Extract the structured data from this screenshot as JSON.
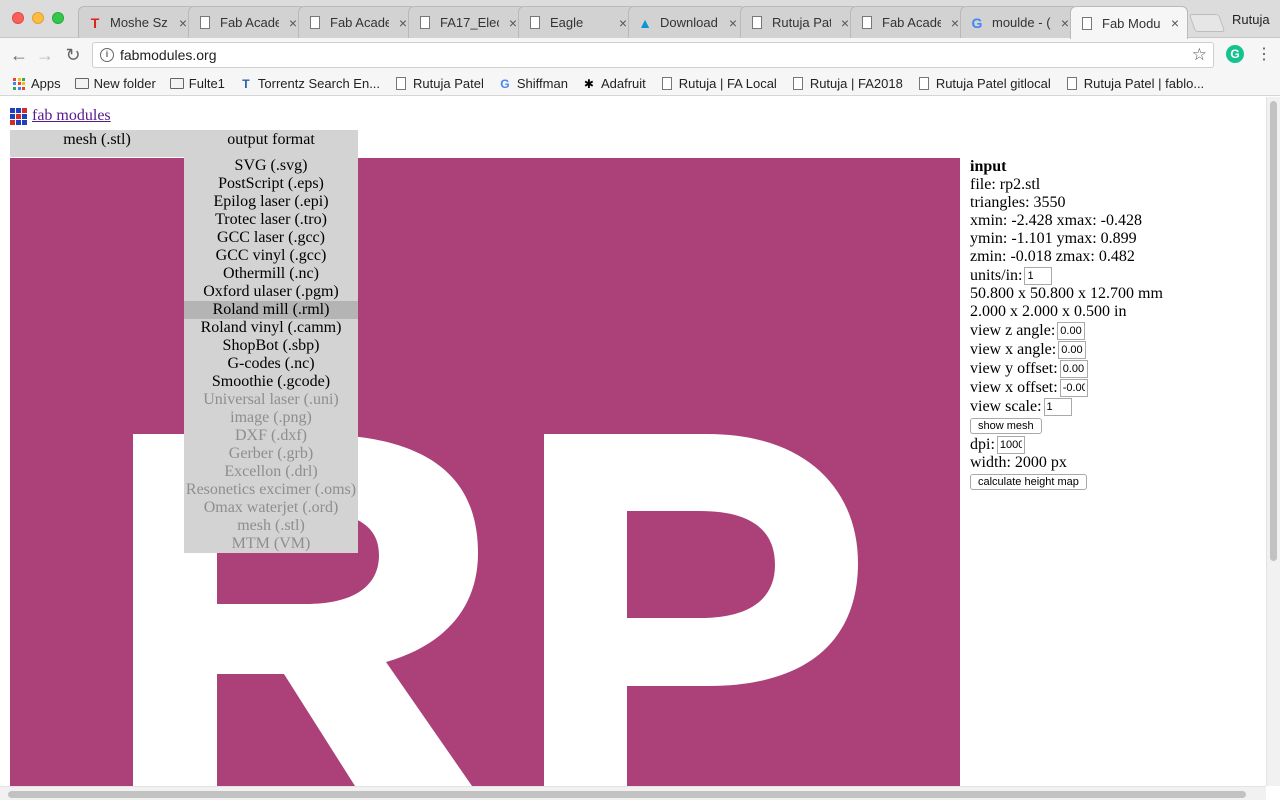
{
  "browser": {
    "tabs": [
      {
        "title": "Moshe Sz",
        "icon": "torrentz-icon"
      },
      {
        "title": "Fab Acade",
        "icon": "page-icon"
      },
      {
        "title": "Fab Acade",
        "icon": "page-icon"
      },
      {
        "title": "FA17_Elect",
        "icon": "page-icon"
      },
      {
        "title": "Eagle",
        "icon": "page-icon"
      },
      {
        "title": "Download",
        "icon": "autodesk-icon"
      },
      {
        "title": "Rutuja Pat",
        "icon": "page-icon"
      },
      {
        "title": "Fab Acade",
        "icon": "page-icon"
      },
      {
        "title": "moulde - (",
        "icon": "google-icon"
      },
      {
        "title": "Fab Modu",
        "icon": "page-icon",
        "active": true
      }
    ],
    "profile_name": "Rutuja",
    "url": "fabmodules.org",
    "bookmarks": [
      {
        "label": "Apps",
        "icon": "apps-icon"
      },
      {
        "label": "New folder",
        "icon": "folder-icon"
      },
      {
        "label": "Fulte1",
        "icon": "folder-icon"
      },
      {
        "label": "Torrentz Search En...",
        "icon": "torrentz-icon"
      },
      {
        "label": "Rutuja Patel",
        "icon": "page-icon"
      },
      {
        "label": "Shiffman",
        "icon": "google-icon"
      },
      {
        "label": "Adafruit",
        "icon": "adafruit-icon"
      },
      {
        "label": "Rutuja | FA Local",
        "icon": "page-icon"
      },
      {
        "label": "Rutuja | FA2018",
        "icon": "page-icon"
      },
      {
        "label": "Rutuja Patel gitlocal",
        "icon": "page-icon"
      },
      {
        "label": "Rutuja Patel | fablo...",
        "icon": "page-icon"
      }
    ]
  },
  "page": {
    "logo_text": "fab modules",
    "input_format": "mesh (.stl)",
    "output_format_label": "output format",
    "output_formats": [
      {
        "label": "SVG (.svg)",
        "enabled": true
      },
      {
        "label": "PostScript (.eps)",
        "enabled": true
      },
      {
        "label": "Epilog laser (.epi)",
        "enabled": true
      },
      {
        "label": "Trotec laser (.tro)",
        "enabled": true
      },
      {
        "label": "GCC laser (.gcc)",
        "enabled": true
      },
      {
        "label": "GCC vinyl (.gcc)",
        "enabled": true
      },
      {
        "label": "Othermill (.nc)",
        "enabled": true
      },
      {
        "label": "Oxford ulaser (.pgm)",
        "enabled": true
      },
      {
        "label": "Roland mill (.rml)",
        "enabled": true,
        "highlighted": true
      },
      {
        "label": "Roland vinyl (.camm)",
        "enabled": true
      },
      {
        "label": "ShopBot (.sbp)",
        "enabled": true
      },
      {
        "label": "G-codes (.nc)",
        "enabled": true
      },
      {
        "label": "Smoothie (.gcode)",
        "enabled": true
      },
      {
        "label": "Universal laser (.uni)",
        "enabled": false
      },
      {
        "label": "image (.png)",
        "enabled": false
      },
      {
        "label": "DXF (.dxf)",
        "enabled": false
      },
      {
        "label": "Gerber (.grb)",
        "enabled": false
      },
      {
        "label": "Excellon (.drl)",
        "enabled": false
      },
      {
        "label": "Resonetics excimer (.oms)",
        "enabled": false
      },
      {
        "label": "Omax waterjet (.ord)",
        "enabled": false
      },
      {
        "label": "mesh (.stl)",
        "enabled": false
      },
      {
        "label": "MTM (VM)",
        "enabled": false
      }
    ],
    "preview": {
      "text": "RP",
      "background_color": "#ac4179",
      "text_color": "#ffffff"
    },
    "info_panel": {
      "heading": "input",
      "file": "file: rp2.stl",
      "triangles": "triangles: 3550",
      "xrange": "xmin: -2.428 xmax: -0.428",
      "yrange": "ymin: -1.101 ymax: 0.899",
      "zrange": "zmin: -0.018 zmax: 0.482",
      "units_label": "units/in:",
      "units_value": "1",
      "size_mm": "50.800 x 50.800 x 12.700 mm",
      "size_in": "2.000 x 2.000 x 0.500 in",
      "view_z_label": "view z angle:",
      "view_z_value": "0.00",
      "view_x_label": "view x angle:",
      "view_x_value": "0.00",
      "view_y_offset_label": "view y offset:",
      "view_y_offset_value": "0.00",
      "view_x_offset_label": "view x offset:",
      "view_x_offset_value": "-0.00",
      "view_scale_label": "view scale:",
      "view_scale_value": "1",
      "show_mesh_button": "show mesh",
      "dpi_label": "dpi:",
      "dpi_value": "1000",
      "width": "width: 2000 px",
      "calc_button": "calculate height map"
    }
  }
}
